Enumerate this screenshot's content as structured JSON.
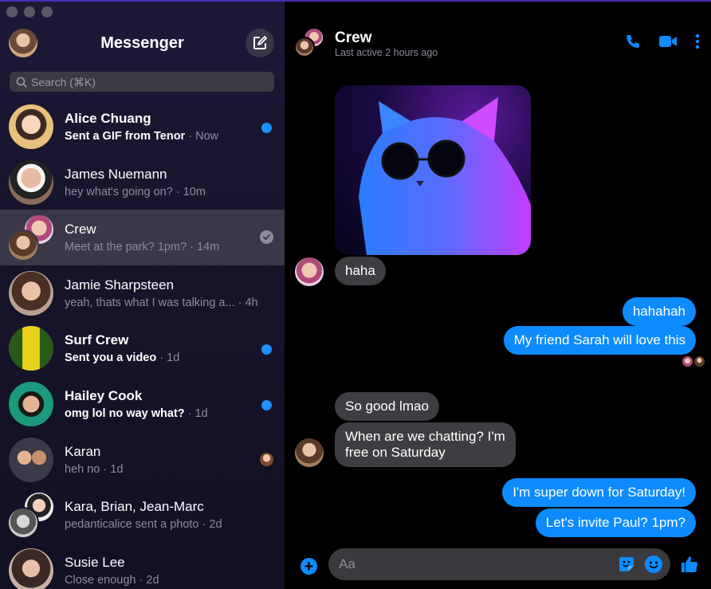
{
  "sidebar": {
    "title": "Messenger",
    "search": {
      "placeholder": "Search (⌘K)"
    },
    "conversations": [
      {
        "name": "Alice Chuang",
        "preview": "Sent a GIF from Tenor",
        "time": "Now",
        "unread": true
      },
      {
        "name": "James Nuemann",
        "preview": "hey what's going on?",
        "time": "10m",
        "unread": false
      },
      {
        "name": "Crew",
        "preview": "Meet at the park? 1pm?",
        "time": "14m",
        "unread": false,
        "active": true
      },
      {
        "name": "Jamie Sharpsteen",
        "preview": "yeah, thats what I was talking a...",
        "time": "4h",
        "unread": false
      },
      {
        "name": "Surf Crew",
        "preview": "Sent you a video",
        "time": "1d",
        "unread": true
      },
      {
        "name": "Hailey Cook",
        "preview": "omg lol no way what?",
        "time": "1d",
        "unread": true
      },
      {
        "name": "Karan",
        "preview": "heh no",
        "time": "1d",
        "unread": false
      },
      {
        "name": "Kara, Brian, Jean-Marc",
        "preview": "pedanticalice sent a photo",
        "time": "2d",
        "unread": false
      },
      {
        "name": "Susie Lee",
        "preview": "Close enough",
        "time": "2d",
        "unread": false
      }
    ]
  },
  "chat": {
    "title": "Crew",
    "status": "Last active 2 hours ago",
    "messages": {
      "m1": "haha",
      "m2": "hahahah",
      "m3": "My friend Sarah will love this",
      "m4": "So good lmao",
      "m5_line1": "When are we chatting? I'm",
      "m5_line2": "free on Saturday",
      "m6": "I'm super down for Saturday!",
      "m7": "Let's invite Paul? 1pm?"
    },
    "composer": {
      "placeholder": "Aa"
    }
  },
  "colors": {
    "accent": "#0d8bff",
    "unread_dot": "#1e90ff",
    "bubble_incoming": "#3e3e42",
    "sidebar_bg": "#1d1838",
    "active_row": "#3a3848"
  },
  "icons": [
    "compose-icon",
    "search-icon",
    "phone-icon",
    "video-icon",
    "more-icon",
    "plus-icon",
    "sticker-icon",
    "emoji-icon",
    "like-icon",
    "check-icon"
  ]
}
